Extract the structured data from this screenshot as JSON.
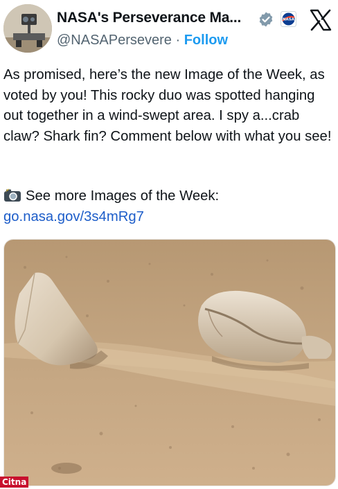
{
  "account": {
    "display_name": "NASA's Perseverance Ma...",
    "handle": "@NASAPersevere",
    "separator": " · ",
    "follow_label": "Follow",
    "avatar_icon": "rover-avatar-icon",
    "verified_icon": "verified-badge-icon",
    "affiliate_icon": "nasa-affiliate-badge-icon"
  },
  "platform": {
    "logo_icon": "x-logo-icon"
  },
  "post": {
    "text": "As promised, here’s the new Image of the Week, as voted by you! This rocky duo was spotted hanging out together in a wind-swept area. I spy a...crab claw? Shark fin? Comment below with what you see!",
    "more_icon": "camera-flash-icon",
    "more_text": "See more Images of the Week:",
    "link_text": "go.nasa.gov/3s4mRg7"
  },
  "media": {
    "image_icon": "mars-rocks-photo"
  },
  "watermark": {
    "text": "Citna"
  },
  "colors": {
    "link": "#1d5dc9",
    "follow": "#1d9bf0",
    "text": "#0f1419",
    "muted": "#536471",
    "watermark_bg": "#c8102e"
  }
}
